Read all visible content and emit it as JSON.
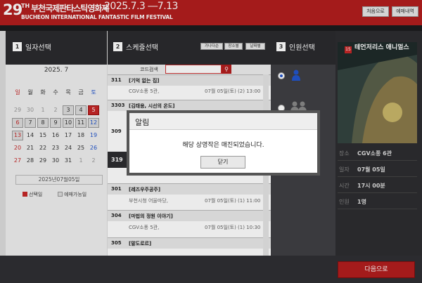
{
  "header": {
    "logo_number": "29",
    "logo_th": "TH",
    "logo_kr": "부천국제판타스틱영화제",
    "logo_date": "2025.7.3 ―7.13",
    "logo_en": "BUCHEON INTERNATIONAL FANTASTIC FILM FESTIVAL",
    "btn_home": "처음으로",
    "btn_guide": "예매내역"
  },
  "steps": {
    "date": {
      "num": "1",
      "title": "일자선택"
    },
    "schedule": {
      "num": "2",
      "title": "스케줄선택"
    },
    "persons": {
      "num": "3",
      "title": "인원선택"
    }
  },
  "calendar": {
    "month": "2025. 7",
    "weekdays": [
      "일",
      "월",
      "화",
      "수",
      "목",
      "금",
      "토"
    ],
    "rows": [
      [
        "29",
        "30",
        "1",
        "2",
        "3",
        "4",
        "5"
      ],
      [
        "6",
        "7",
        "8",
        "9",
        "10",
        "11",
        "12"
      ],
      [
        "13",
        "14",
        "15",
        "16",
        "17",
        "18",
        "19"
      ],
      [
        "20",
        "21",
        "22",
        "23",
        "24",
        "25",
        "26"
      ],
      [
        "27",
        "28",
        "29",
        "30",
        "31",
        "1",
        "2"
      ]
    ],
    "selected_label": "2025년07월05일",
    "legend_selected": "선택일",
    "legend_available": "예매가능일"
  },
  "schedule": {
    "sort_buttons": [
      "가나다순",
      "장소별",
      "날짜별"
    ],
    "search_label": "코드검색",
    "search_value": "",
    "films": [
      {
        "code": "311",
        "title": "[기억 없는 집]",
        "place": "CGV소풍 5관,",
        "when": "07월 05일(토) (2) 13:00"
      },
      {
        "code": "3303",
        "title": "[김태용, 시선의 온도]",
        "place": "",
        "when": ""
      },
      {
        "code": "309",
        "title": "",
        "place": "",
        "when": ""
      },
      {
        "code": "319",
        "title": "",
        "place": "",
        "when": ""
      },
      {
        "code": "301",
        "title": "[레즈우주공주]",
        "place": "부천시청 어울마당,",
        "when": "07월 05일(토) (1) 11:00"
      },
      {
        "code": "304",
        "title": "[마법의 정원 이야기]",
        "place": "CGV소풍 5관,",
        "when": "07월 05일(토) (1) 10:30"
      },
      {
        "code": "305",
        "title": "[말도로르]",
        "place": "",
        "when": ""
      }
    ]
  },
  "summary": {
    "rating": "15",
    "poster_title": "테언저리스 애니멀스",
    "rows": [
      {
        "k": "장소",
        "v": "CGV소풍 6관"
      },
      {
        "k": "일자",
        "v": "07월 05일"
      },
      {
        "k": "시간",
        "v": "17시 00분"
      },
      {
        "k": "인원",
        "v": "1명"
      }
    ]
  },
  "footer": {
    "next": "다음으로"
  },
  "modal": {
    "title": "알림",
    "message": "해당 상영작은 매진되었습니다.",
    "close": "닫기"
  },
  "colors": {
    "brand_red": "#b21e1e",
    "dark": "#2d2d30"
  }
}
